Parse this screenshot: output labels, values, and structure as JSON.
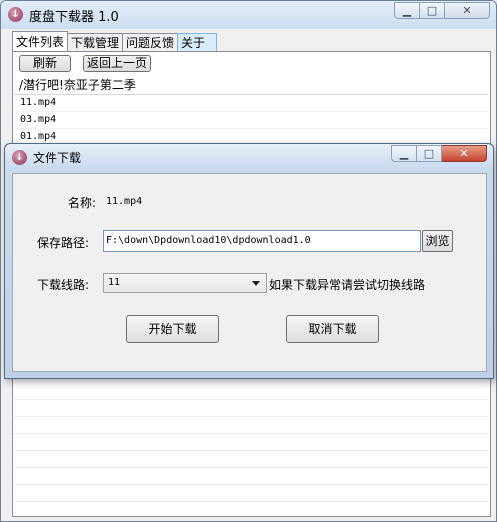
{
  "main": {
    "title": "度盘下载器 1.0",
    "tabs": [
      "文件列表",
      "下载管理",
      "问题反馈",
      "关于"
    ],
    "refresh_label": "刷新",
    "back_label": "返回上一页",
    "current_path": "/潜行吧!奈亚子第二季",
    "files": [
      "11.mp4",
      "03.mp4",
      "01.mp4"
    ]
  },
  "dialog": {
    "title": "文件下载",
    "name_label": "名称:",
    "name_value": "11.mp4",
    "save_path_label": "保存路径:",
    "save_path_value": "F:\\down\\Dpdownload10\\dpdownload1.0",
    "browse_label": "浏览",
    "line_label": "下载线路:",
    "line_value": "11",
    "line_hint": "如果下载异常请尝试切换线路",
    "start_label": "开始下载",
    "cancel_label": "取消下载"
  },
  "icons": {
    "app": "download-arrow-icon",
    "minimize": "minimize-icon",
    "maximize": "maximize-icon",
    "close": "close-icon",
    "dropdown": "chevron-down-icon"
  }
}
